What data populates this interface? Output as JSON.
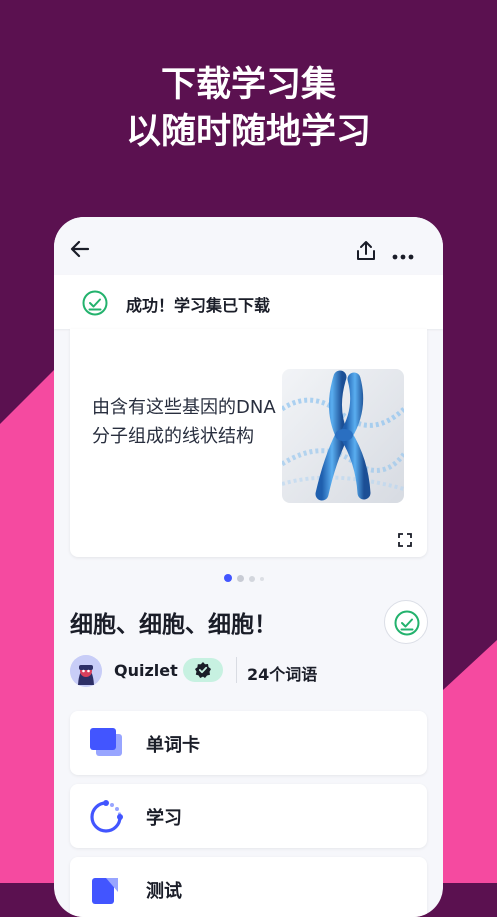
{
  "promo": {
    "headline_line1": "下载学习集",
    "headline_line2": "以随时随地学习"
  },
  "colors": {
    "background_purple": "#5b1150",
    "background_pink": "#f54aa0",
    "accent_blue": "#4255ff",
    "success_green": "#23b26d"
  },
  "toolbar": {
    "back_icon": "arrow-left-icon",
    "share_icon": "share-icon",
    "more_icon": "more-horizontal-icon"
  },
  "toast": {
    "icon": "check-circle-icon",
    "message": "成功！学习集已下载"
  },
  "flashcard": {
    "definition": "由含有这些基因的DNA分子组成的线状结构",
    "image_alt": "chromosome",
    "expand_icon": "expand-icon"
  },
  "pager": {
    "total": 4,
    "current": 1
  },
  "set": {
    "title": "细胞、细胞、细胞！",
    "downloaded_icon": "check-circle-icon",
    "creator": "Quizlet",
    "verified_icon": "verified-badge-icon",
    "term_count": "24个词语"
  },
  "study_modes": [
    {
      "label": "单词卡",
      "icon": "flashcards-icon"
    },
    {
      "label": "学习",
      "icon": "learn-icon"
    },
    {
      "label": "测试",
      "icon": "test-icon"
    }
  ]
}
